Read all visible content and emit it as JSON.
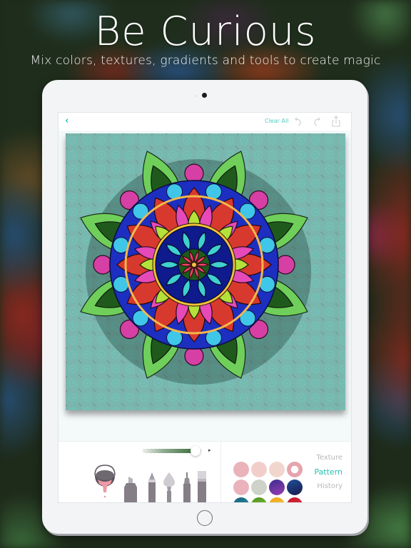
{
  "promo": {
    "headline": "Be Curious",
    "subline": "Mix colors, textures, gradients and tools to create magic"
  },
  "toolbar": {
    "back_icon": "chevron-left-icon",
    "back_glyph": "‹",
    "clear_all_label": "Clear All",
    "undo_icon": "undo-icon",
    "redo_icon": "redo-icon",
    "share_icon": "share-icon"
  },
  "artwork": {
    "description": "Colored mandala on teal patterned background",
    "background_color": "#7ab6ad"
  },
  "brush_size_slider": {
    "value": 0.9,
    "color": "#3d6e3e"
  },
  "tools": [
    {
      "name": "paint-bucket",
      "selected": true
    },
    {
      "name": "marker"
    },
    {
      "name": "pencil"
    },
    {
      "name": "brush"
    },
    {
      "name": "fineliner"
    },
    {
      "name": "eraser"
    }
  ],
  "swatch_tabs": [
    {
      "label": "Texture",
      "active": false
    },
    {
      "label": "Pattern",
      "active": true
    },
    {
      "label": "History",
      "active": false
    }
  ],
  "swatches": [
    {
      "color": "#e6a4ad",
      "pattern": "dots"
    },
    {
      "color": "#f0c6c0",
      "pattern": "dots"
    },
    {
      "color": "#eecfc3",
      "pattern": "dots"
    },
    {
      "color": "#e6a4ad",
      "pattern": "ring"
    },
    {
      "color": "#e6a6b0",
      "pattern": "dots"
    },
    {
      "color": "#c6cbc0",
      "pattern": "dots"
    },
    {
      "color": "#3a2d8e",
      "pattern": "gradient",
      "color2": "#9b3db5"
    },
    {
      "color": "#1e4f9c",
      "pattern": "gradient",
      "color2": "#1a1a4a"
    },
    {
      "color": "#1a5f7a",
      "pattern": "gradient",
      "color2": "#2b9bb5"
    },
    {
      "color": "#4d8f1e",
      "pattern": "gradient",
      "color2": "#8fcf3a"
    },
    {
      "color": "#f0a21e",
      "pattern": "gradient",
      "color2": "#f6d43a"
    },
    {
      "color": "#c3142a",
      "pattern": "gradient",
      "color2": "#e8384a"
    }
  ]
}
